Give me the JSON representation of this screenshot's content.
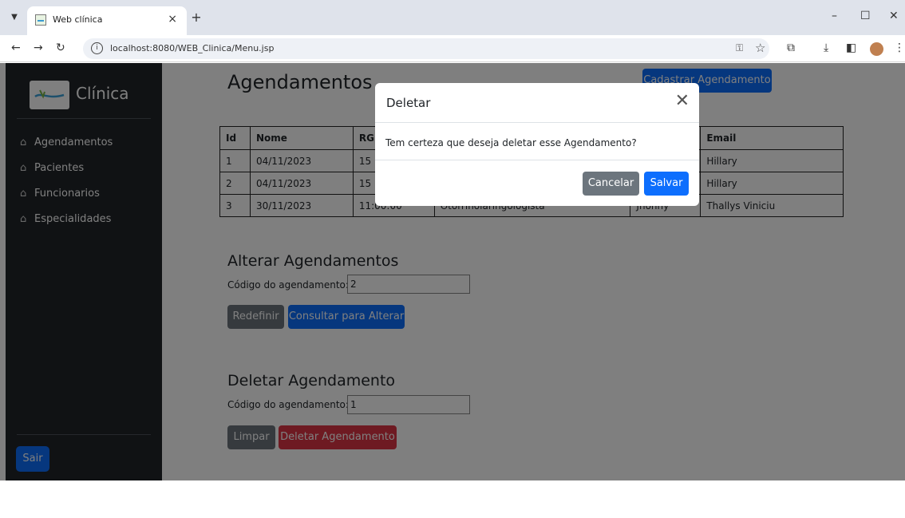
{
  "browser": {
    "tab_title": "Web clínica",
    "tab_close": "×",
    "new_tab": "+",
    "url": "localhost:8080/WEB_Clinica/Menu.jsp",
    "window_controls": {
      "minimize": "–",
      "maximize": "☐",
      "close": "✕"
    }
  },
  "sidebar": {
    "brand": "Clínica",
    "items": [
      {
        "label": "Agendamentos",
        "icon": "home-icon"
      },
      {
        "label": "Pacientes",
        "icon": "home-icon"
      },
      {
        "label": "Funcionarios",
        "icon": "home-icon"
      },
      {
        "label": "Especialidades",
        "icon": "home-icon"
      }
    ],
    "logout": "Sair"
  },
  "main": {
    "title": "Agendamentos",
    "add_button": "Cadastrar Agendamento",
    "table": {
      "headers": [
        "Id",
        "Nome",
        "RG",
        "",
        "",
        "Email"
      ],
      "rows": [
        [
          "1",
          "04/11/2023",
          "15",
          "",
          "",
          "Hillary"
        ],
        [
          "2",
          "04/11/2023",
          "15",
          "",
          "",
          "Hillary"
        ],
        [
          "3",
          "30/11/2023",
          "11:00:00",
          "Otorrinolaringologista",
          "Jhonny",
          "Thallys Viniciu"
        ]
      ]
    },
    "alter": {
      "title": "Alterar Agendamentos",
      "label": "Código do agendamento:",
      "value": "2",
      "reset": "Redefinir",
      "submit": "Consultar para Alterar"
    },
    "delete": {
      "title": "Deletar Agendamento",
      "label": "Código do agendamento:",
      "value": "1",
      "clear": "Limpar",
      "submit": "Deletar Agendamento"
    }
  },
  "modal": {
    "title": "Deletar",
    "close": "✕",
    "message": "Tem certeza que deseja deletar esse Agendamento?",
    "cancel": "Cancelar",
    "save": "Salvar"
  },
  "colors": {
    "primary": "#0d6efd",
    "secondary": "#6c757d",
    "danger": "#dc3545",
    "sidebar": "#212529"
  }
}
